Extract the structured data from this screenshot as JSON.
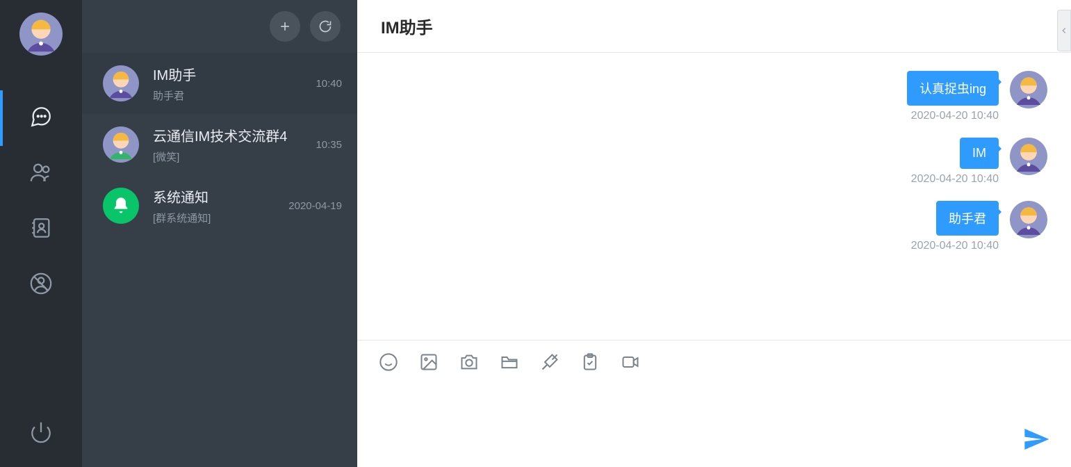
{
  "chat": {
    "title": "IM助手",
    "messages": [
      {
        "text": "认真捉虫ing",
        "time": "2020-04-20 10:40",
        "mine": true
      },
      {
        "text": "IM",
        "time": "2020-04-20 10:40",
        "mine": true
      },
      {
        "text": "助手君",
        "time": "2020-04-20 10:40",
        "mine": true
      }
    ],
    "composer": {
      "placeholder": ""
    }
  },
  "conversations": [
    {
      "name": "IM助手",
      "preview": "助手君",
      "time": "10:40",
      "avatar": "cartoon-purple",
      "active": true
    },
    {
      "name": "云通信IM技术交流群4",
      "preview": "[微笑]",
      "time": "10:35",
      "avatar": "cartoon-green",
      "active": false
    },
    {
      "name": "系统通知",
      "preview": "[群系统通知]",
      "time": "2020-04-19",
      "avatar": "bell",
      "active": false
    }
  ],
  "nav": {
    "selected": "chat",
    "items": [
      "chat",
      "contacts",
      "addressbook",
      "blocked",
      "power"
    ]
  },
  "self": {
    "avatar": "cartoon-purple"
  }
}
